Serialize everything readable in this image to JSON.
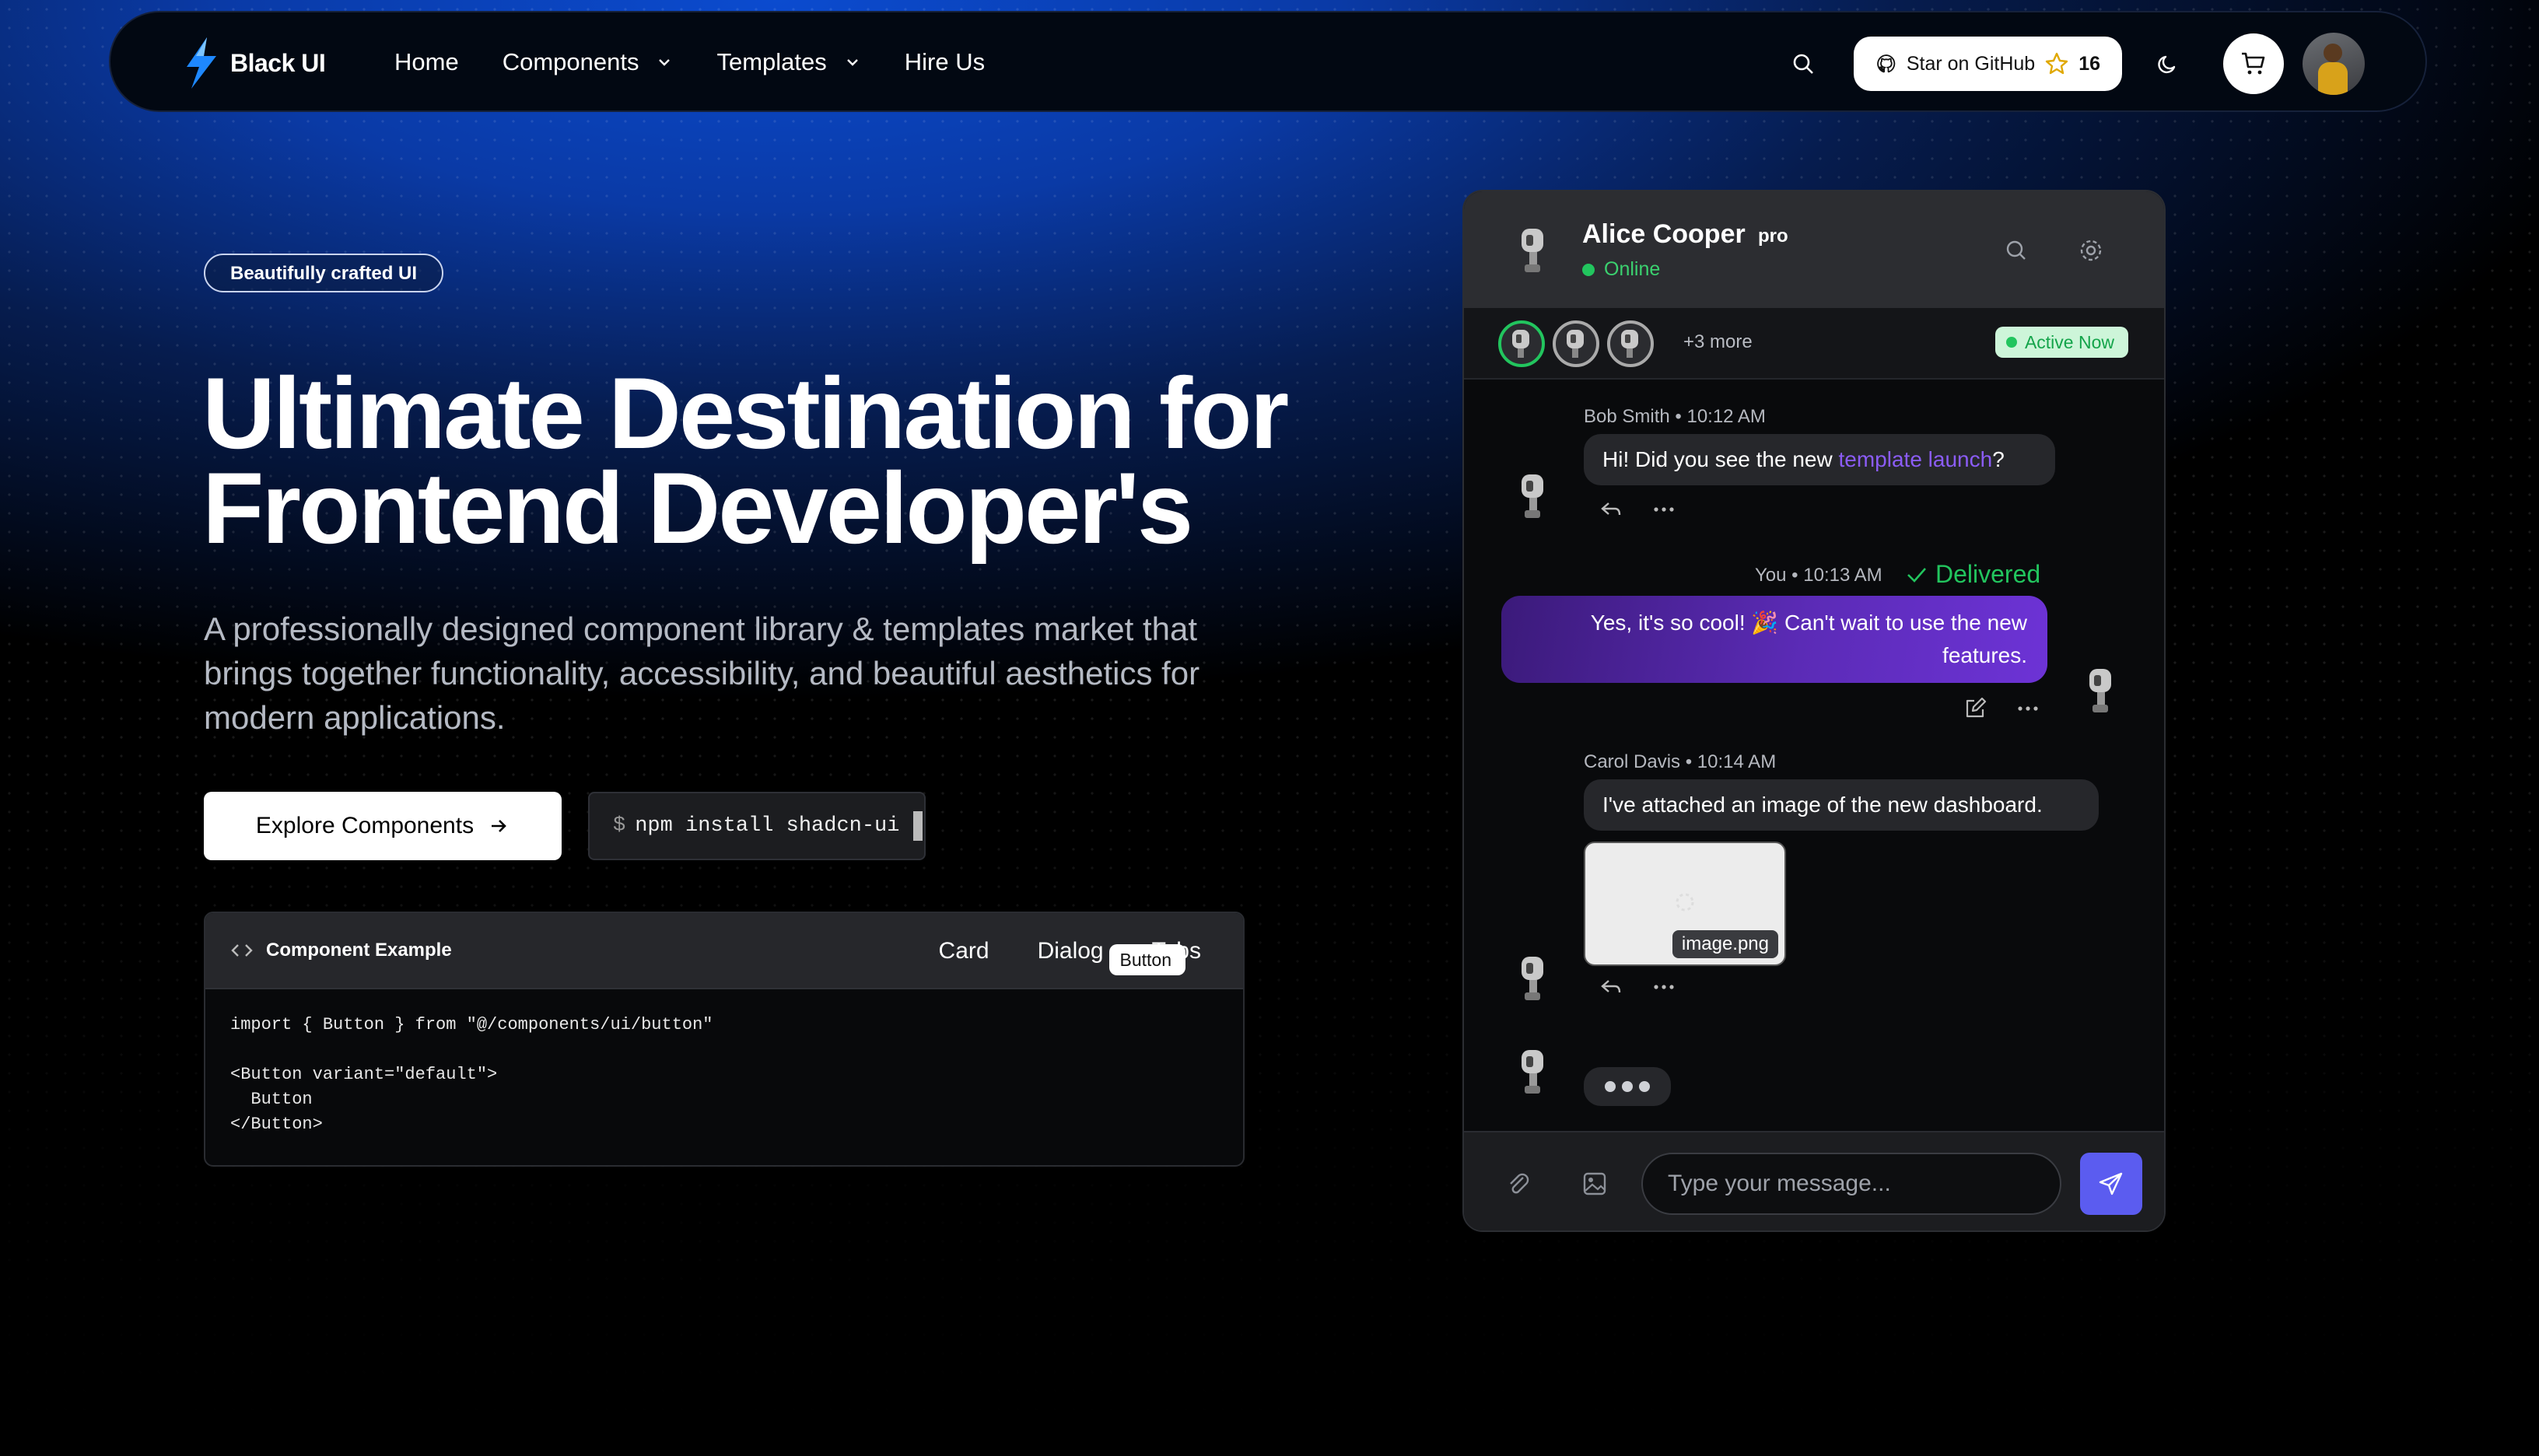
{
  "nav": {
    "brand": "Black UI",
    "links": [
      {
        "label": "Home",
        "has_dropdown": false
      },
      {
        "label": "Components",
        "has_dropdown": true
      },
      {
        "label": "Templates",
        "has_dropdown": true
      },
      {
        "label": "Hire Us",
        "has_dropdown": false
      }
    ],
    "github_label": "Star on GitHub",
    "github_stars": "16",
    "icons": [
      "search-icon",
      "github-icon",
      "star-icon",
      "moon-icon",
      "cart-icon"
    ]
  },
  "hero": {
    "badge": "Beautifully crafted UI",
    "title_line1": "Ultimate Destination for",
    "title_line2": "Frontend Developer's",
    "subtitle": "A professionally designed component library & templates market that brings together functionality, accessibility, and beautiful aesthetics for modern applications.",
    "cta_label": "Explore Components",
    "npm_prefix": "$",
    "npm_command": "npm install shadcn-ui"
  },
  "code_example": {
    "title": "Component Example",
    "tabs": [
      "Button",
      "Card",
      "Dialog",
      "Tabs"
    ],
    "active_tab": "Button",
    "code": "import { Button } from \"@/components/ui/button\"\n\n<Button variant=\"default\">\n  Button\n</Button>"
  },
  "chat": {
    "contact_name": "Alice Cooper",
    "contact_badge": "pro",
    "status": "Online",
    "members_more": "+3 more",
    "active_label": "Active Now",
    "messages": [
      {
        "author": "Bob Smith",
        "time": "10:12 AM",
        "text_before": "Hi! Did you see the new ",
        "link": "template launch",
        "text_after": "?"
      },
      {
        "author": "You",
        "time": "10:13 AM",
        "status": "Delivered",
        "text": "Yes, it's so cool! 🎉 Can't wait to use the new features."
      },
      {
        "author": "Carol Davis",
        "time": "10:14 AM",
        "text": "I've attached an image of the new dashboard.",
        "attachment": "image.png"
      }
    ],
    "composer_placeholder": "Type your message..."
  },
  "colors": {
    "accent": "#5b5cf0",
    "online": "#22c55e",
    "link": "#8b5cf6",
    "sent_bubble": "#5b2bb6"
  }
}
